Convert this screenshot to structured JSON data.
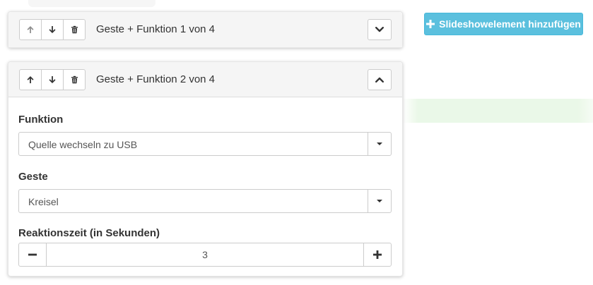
{
  "colors": {
    "accent_info": "#5bc0de",
    "panel_header_bg": "#f5f5f5",
    "border": "#cccccc",
    "text": "#333333"
  },
  "add_button": {
    "icon": "plus-icon",
    "label": "Slideshowelement hinzufügen"
  },
  "panels": [
    {
      "title": "Geste + Funktion 1 von 4",
      "toggle_icon": "chevron-down-icon",
      "controls": [
        "arrow-up-icon",
        "arrow-down-icon",
        "trash-icon"
      ]
    },
    {
      "title": "Geste + Funktion 2 von 4",
      "toggle_icon": "chevron-up-icon",
      "controls": [
        "arrow-up-icon",
        "arrow-down-icon",
        "trash-icon"
      ],
      "fields": {
        "function": {
          "label": "Funktion",
          "value": "Quelle wechseln zu USB"
        },
        "gesture": {
          "label": "Geste",
          "value": "Kreisel"
        },
        "reaction": {
          "label": "Reaktionszeit (in Sekunden)",
          "value": "3",
          "minus_icon": "minus-icon",
          "plus_icon": "plus-icon"
        }
      }
    }
  ]
}
